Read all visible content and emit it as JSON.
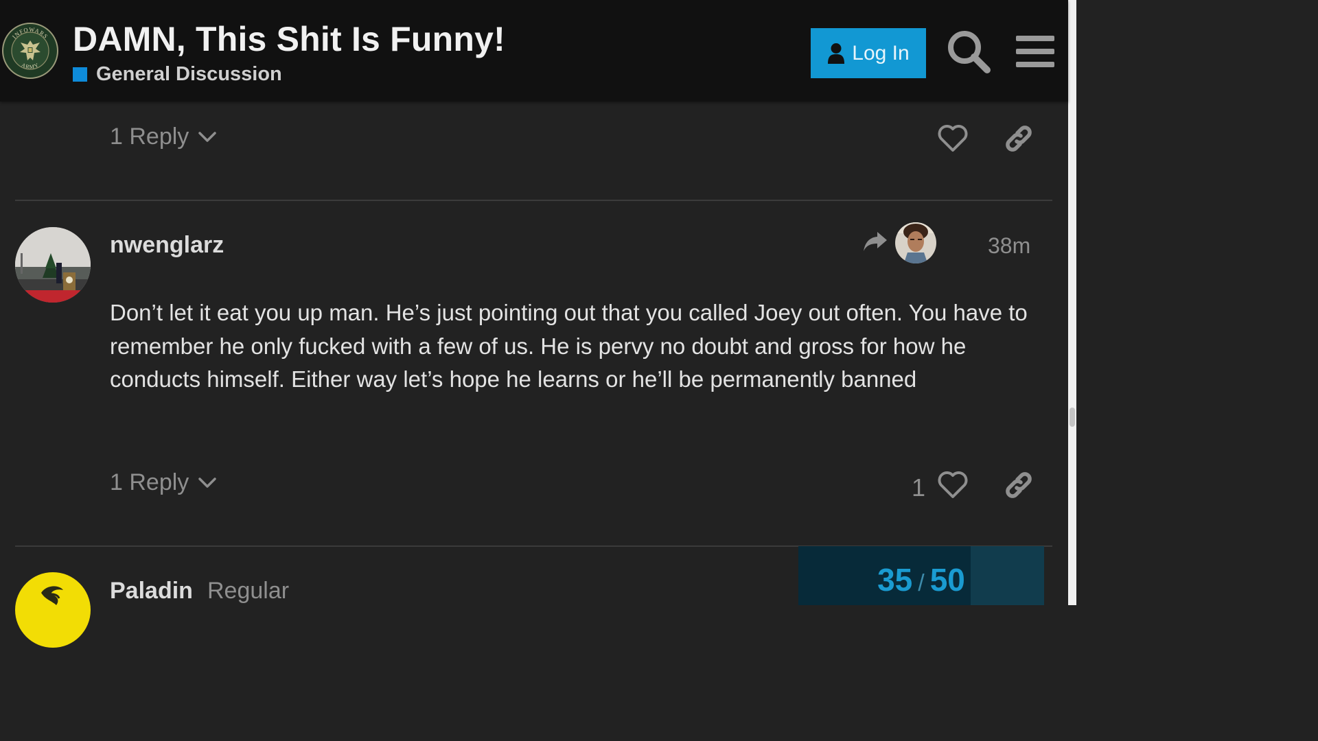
{
  "header": {
    "title": "DAMN, This Shit Is Funny!",
    "category": {
      "name": "General Discussion",
      "color": "#0e8bd9"
    },
    "login_label": "Log In",
    "logo_text": {
      "top": "INFOWARS",
      "bottom": "ARMY"
    }
  },
  "posts": [
    {
      "reply_count_label": "1 Reply",
      "likes": ""
    },
    {
      "username": "nwenglarz",
      "date": "38m",
      "reply_to_icon": "share-arrow-icon",
      "body": "Don’t let it eat you up man. He’s just pointing out that you called Joey out often. You have to remember he only fucked with a few of us. He is pervy no doubt and gross for how he conducts himself. Either way let’s hope he learns or he’ll be permanently banned",
      "reply_count_label": "1 Reply",
      "likes": "1"
    },
    {
      "username": "Paladin",
      "user_title": "Regular"
    }
  ],
  "timeline": {
    "current": "35",
    "separator": "/",
    "total": "50",
    "progress_fraction": 0.7
  },
  "colors": {
    "background": "#222222",
    "header_bg": "#111111",
    "accent": "#1298d3",
    "muted_text": "#8f8f8f"
  }
}
